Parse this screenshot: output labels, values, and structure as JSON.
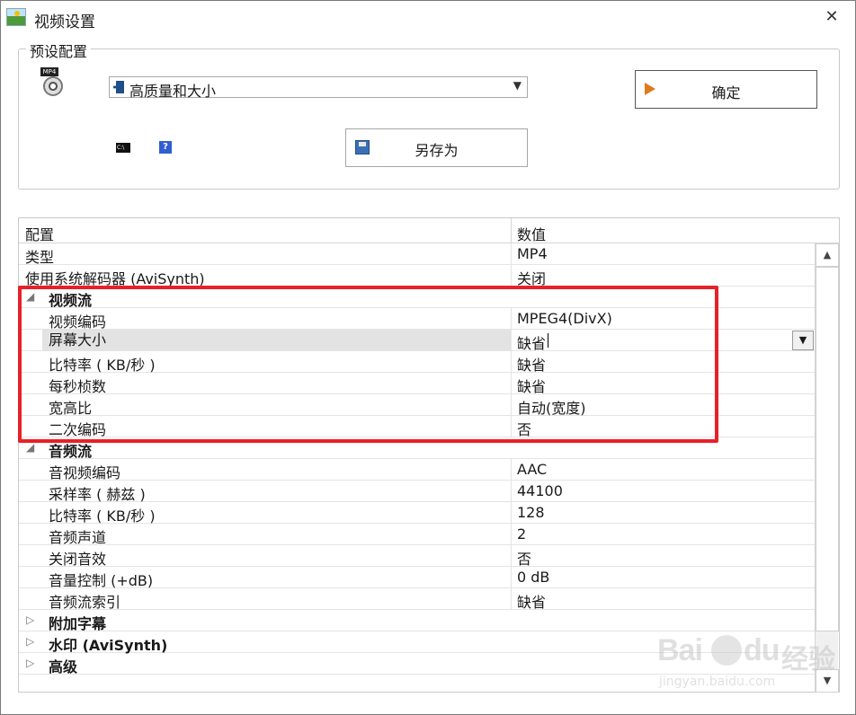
{
  "window": {
    "title": "视频设置",
    "close_glyph": "✕"
  },
  "preset": {
    "group_label": "预设配置",
    "format_badge": "MP4",
    "selected_profile": "高质量和大小",
    "ok_label": "确定",
    "save_as_label": "另存为",
    "cmd_badge": "C:\\",
    "help_glyph": "?"
  },
  "grid": {
    "headers": {
      "name": "配置",
      "value": "数值"
    },
    "rows": [
      {
        "type": "item",
        "name": "类型",
        "value": "MP4"
      },
      {
        "type": "item",
        "name": "使用系统解码器 (AviSynth)",
        "value": "关闭"
      },
      {
        "type": "group",
        "name": "视频流",
        "expanded": true
      },
      {
        "type": "child",
        "name": "视频编码",
        "value": "MPEG4(DivX)"
      },
      {
        "type": "child",
        "name": "屏幕大小",
        "value": "缺省",
        "selected": true
      },
      {
        "type": "child",
        "name": "比特率 ( KB/秒 )",
        "value": "缺省"
      },
      {
        "type": "child",
        "name": "每秒桢数",
        "value": "缺省"
      },
      {
        "type": "child",
        "name": "宽高比",
        "value": "自动(宽度)"
      },
      {
        "type": "child",
        "name": "二次编码",
        "value": "否"
      },
      {
        "type": "group",
        "name": "音频流",
        "expanded": true
      },
      {
        "type": "child",
        "name": "音视频编码",
        "value": "AAC"
      },
      {
        "type": "child",
        "name": "采样率 ( 赫兹 )",
        "value": "44100"
      },
      {
        "type": "child",
        "name": "比特率 ( KB/秒 )",
        "value": "128"
      },
      {
        "type": "child",
        "name": "音频声道",
        "value": "2"
      },
      {
        "type": "child",
        "name": "关闭音效",
        "value": "否"
      },
      {
        "type": "child",
        "name": "音量控制 (+dB)",
        "value": "0 dB"
      },
      {
        "type": "child",
        "name": "音频流索引",
        "value": "缺省"
      },
      {
        "type": "group",
        "name": "附加字幕",
        "expanded": false
      },
      {
        "type": "group",
        "name": "水印 (AviSynth)",
        "expanded": false
      },
      {
        "type": "group",
        "name": "高级",
        "expanded": false
      }
    ]
  },
  "scrollbar": {
    "up_glyph": "▲",
    "down_glyph": "▼"
  },
  "watermark": {
    "brand": "Bai",
    "suffix": "du",
    "cn": "经验",
    "url": "jingyan.baidu.com"
  },
  "colors": {
    "highlight": "#e8202a",
    "selected_row": "#e3e3e3"
  }
}
